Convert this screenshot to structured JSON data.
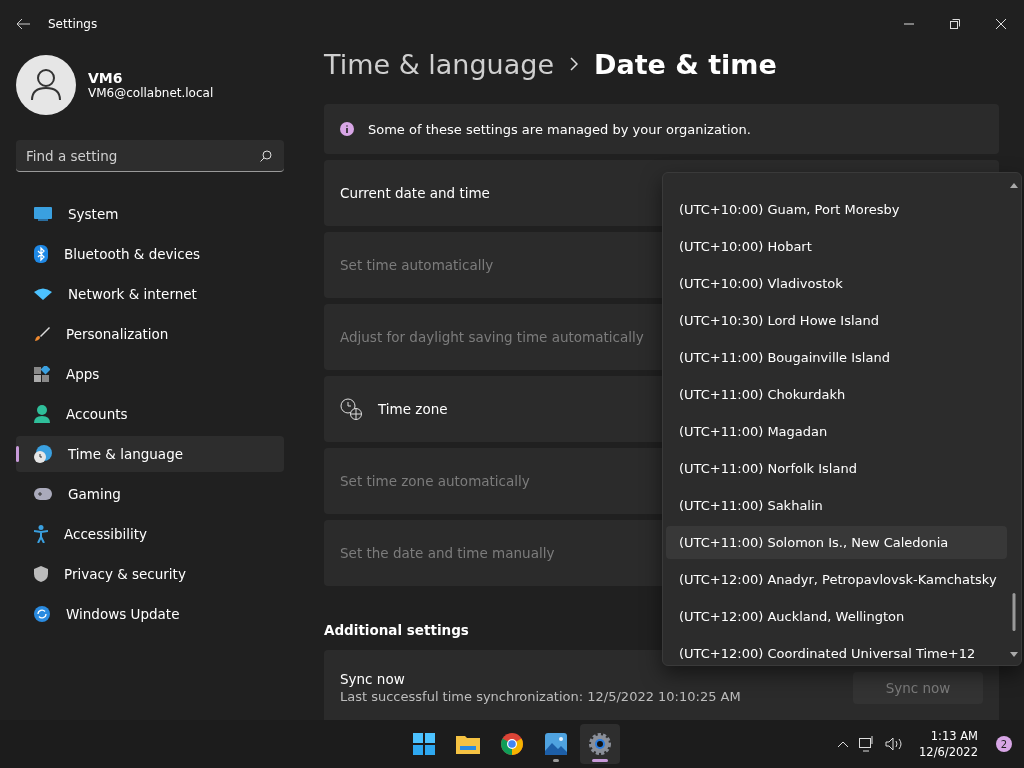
{
  "window": {
    "title": "Settings"
  },
  "user": {
    "name": "VM6",
    "email": "VM6@collabnet.local"
  },
  "search": {
    "placeholder": "Find a setting"
  },
  "nav": [
    {
      "label": "System",
      "selected": false
    },
    {
      "label": "Bluetooth & devices",
      "selected": false
    },
    {
      "label": "Network & internet",
      "selected": false
    },
    {
      "label": "Personalization",
      "selected": false
    },
    {
      "label": "Apps",
      "selected": false
    },
    {
      "label": "Accounts",
      "selected": false
    },
    {
      "label": "Time & language",
      "selected": true
    },
    {
      "label": "Gaming",
      "selected": false
    },
    {
      "label": "Accessibility",
      "selected": false
    },
    {
      "label": "Privacy & security",
      "selected": false
    },
    {
      "label": "Windows Update",
      "selected": false
    }
  ],
  "breadcrumb": [
    "Time & language",
    "Date & time"
  ],
  "banner": "Some of these settings are managed by your organization.",
  "settings": [
    {
      "label": "Current date and time",
      "disabled": false,
      "kind": "plain"
    },
    {
      "label": "Set time automatically",
      "disabled": true,
      "kind": "plain"
    },
    {
      "label": "Adjust for daylight saving time automatically",
      "disabled": true,
      "kind": "plain"
    },
    {
      "label": "Time zone",
      "disabled": false,
      "kind": "zone"
    },
    {
      "label": "Set time zone automatically",
      "disabled": true,
      "kind": "plain"
    },
    {
      "label": "Set the date and time manually",
      "disabled": true,
      "kind": "plain"
    }
  ],
  "additional": {
    "heading": "Additional settings",
    "title": "Sync now",
    "detail": "Last successful time synchronization: 12/5/2022 10:10:25 AM",
    "button": "Sync now",
    "button_disabled": true
  },
  "dropdown": [
    {
      "label": "(UTC+10:00) Guam, Port Moresby",
      "selected": false
    },
    {
      "label": "(UTC+10:00) Hobart",
      "selected": false
    },
    {
      "label": "(UTC+10:00) Vladivostok",
      "selected": false
    },
    {
      "label": "(UTC+10:30) Lord Howe Island",
      "selected": false
    },
    {
      "label": "(UTC+11:00) Bougainville Island",
      "selected": false
    },
    {
      "label": "(UTC+11:00) Chokurdakh",
      "selected": false
    },
    {
      "label": "(UTC+11:00) Magadan",
      "selected": false
    },
    {
      "label": "(UTC+11:00) Norfolk Island",
      "selected": false
    },
    {
      "label": "(UTC+11:00) Sakhalin",
      "selected": false
    },
    {
      "label": "(UTC+11:00) Solomon Is., New Caledonia",
      "selected": true
    },
    {
      "label": "(UTC+12:00) Anadyr, Petropavlovsk-Kamchatsky",
      "selected": false
    },
    {
      "label": "(UTC+12:00) Auckland, Wellington",
      "selected": false
    },
    {
      "label": "(UTC+12:00) Coordinated Universal Time+12",
      "selected": false
    }
  ],
  "taskbar": {
    "apps": [
      {
        "running": false,
        "active": false
      },
      {
        "running": false,
        "active": false
      },
      {
        "running": false,
        "active": false
      },
      {
        "running": true,
        "active": false
      },
      {
        "running": true,
        "active": true
      }
    ],
    "time": "1:13 AM",
    "date": "12/6/2022",
    "badge": "2"
  }
}
